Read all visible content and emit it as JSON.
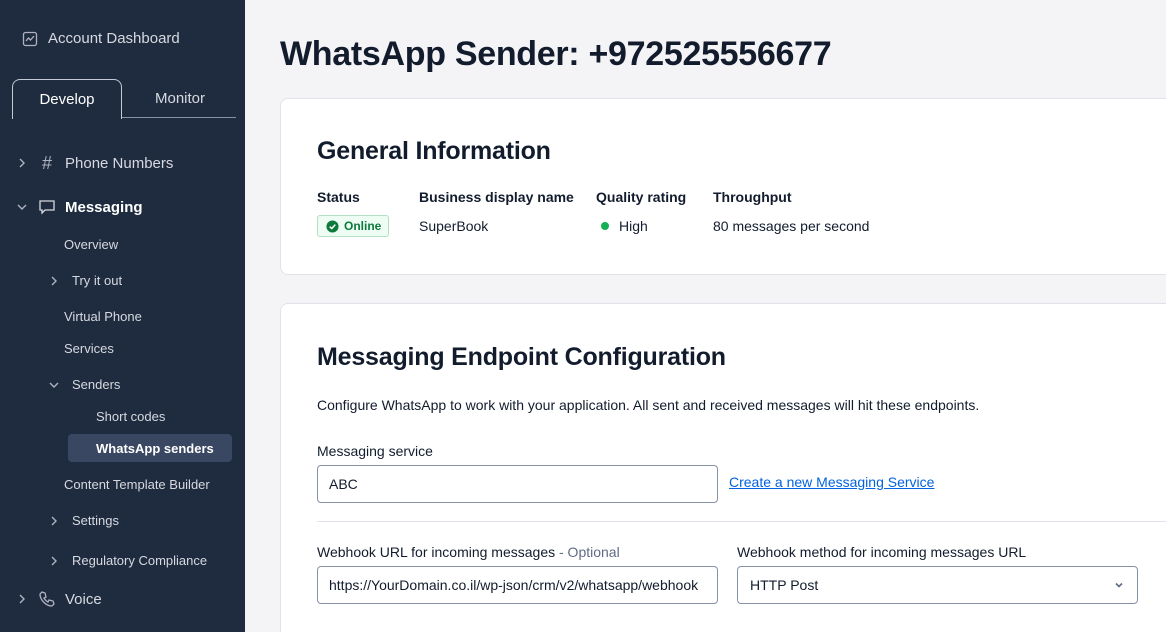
{
  "sidebar": {
    "account_label": "Account Dashboard",
    "tabs": {
      "develop": "Develop",
      "monitor": "Monitor"
    },
    "items": {
      "phone_numbers": "Phone Numbers",
      "messaging": "Messaging",
      "overview": "Overview",
      "try_it_out": "Try it out",
      "virtual_phone": "Virtual Phone",
      "services": "Services",
      "senders": "Senders",
      "short_codes": "Short codes",
      "whatsapp_senders": "WhatsApp senders",
      "content_template_builder": "Content Template Builder",
      "settings": "Settings",
      "regulatory_compliance": "Regulatory Compliance",
      "voice": "Voice"
    },
    "icons": {
      "hash": "#"
    }
  },
  "main": {
    "title": "WhatsApp Sender: +972525556677",
    "general": {
      "title": "General Information",
      "status_label": "Status",
      "status_value": "Online",
      "business_name_label": "Business display name",
      "business_name_value": "SuperBook",
      "quality_label": "Quality rating",
      "quality_value": "High",
      "throughput_label": "Throughput",
      "throughput_value": "80 messages per second"
    },
    "endpoint": {
      "title": "Messaging Endpoint Configuration",
      "description": "Configure WhatsApp to work with your application. All sent and received messages will hit these endpoints.",
      "messaging_service_label": "Messaging service",
      "messaging_service_value": "ABC",
      "create_link": "Create a new Messaging Service",
      "webhook_url_label": "Webhook URL for incoming messages",
      "webhook_url_optional": " - Optional",
      "webhook_url_value": "https://YourDomain.co.il/wp-json/crm/v2/whatsapp/webhook",
      "webhook_method_label": "Webhook method for incoming messages URL",
      "webhook_method_value": "HTTP Post"
    }
  },
  "colors": {
    "sidebar_bg": "#1f2c3f",
    "selected_bg": "#394762",
    "online_green": "#14b053",
    "link_blue": "#0263e0"
  }
}
